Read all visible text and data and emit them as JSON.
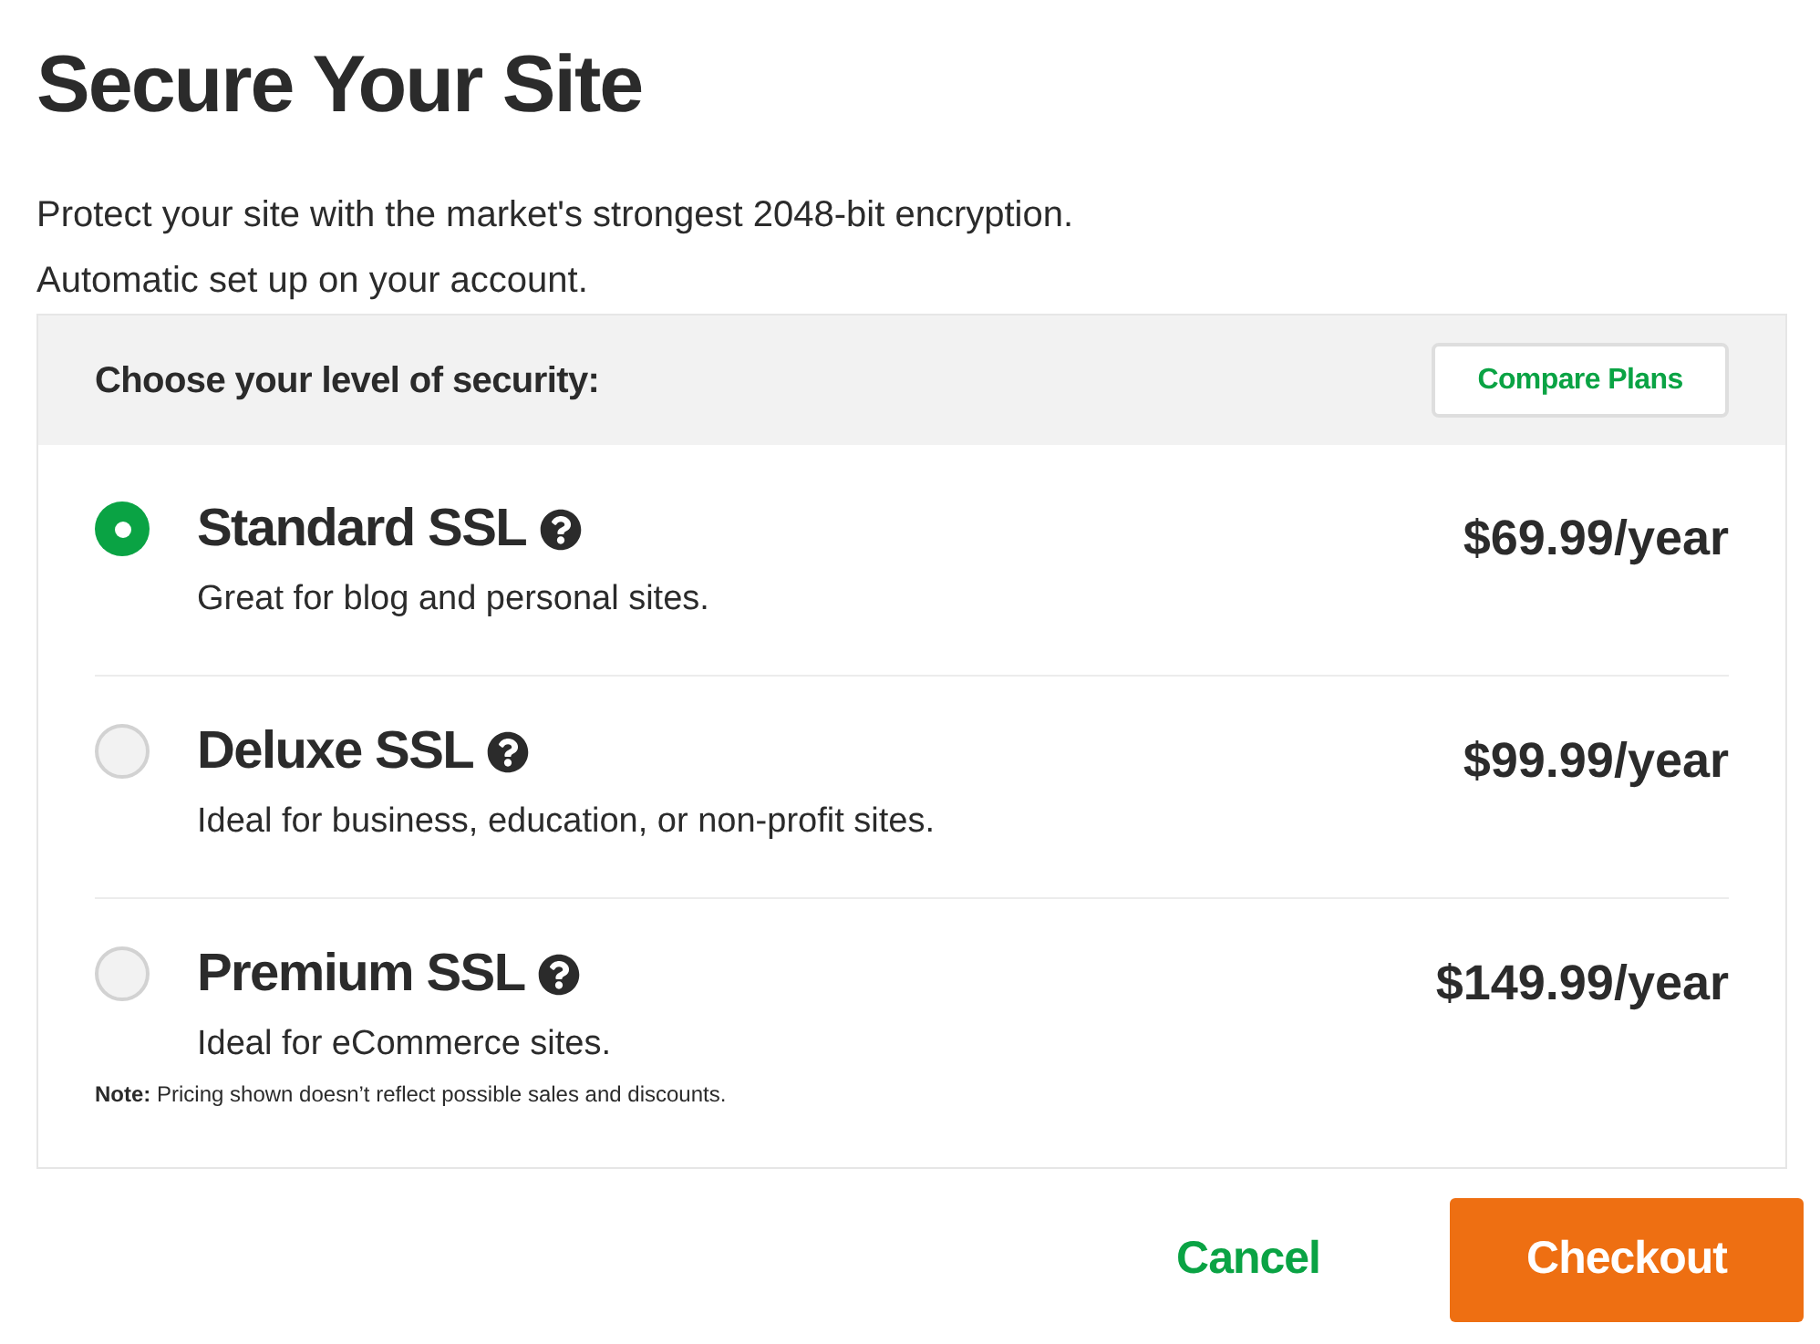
{
  "dialog": {
    "title": "Secure Your Site",
    "intro": [
      "Protect your site with the market's strongest 2048-bit encryption.",
      "Automatic set up on your account."
    ]
  },
  "plans_panel": {
    "heading": "Choose your level of security:",
    "compare_button": "Compare Plans",
    "plans": [
      {
        "name": "Standard SSL",
        "description": "Great for blog and personal sites.",
        "price": "$69.99/year",
        "selected": true
      },
      {
        "name": "Deluxe SSL",
        "description": "Ideal for business, education, or non-profit sites.",
        "price": "$99.99/year",
        "selected": false
      },
      {
        "name": "Premium SSL",
        "description": "Ideal for eCommerce sites.",
        "price": "$149.99/year",
        "selected": false
      }
    ],
    "note": "**Note:** Pricing shown doesn’t reflect possible sales and discounts."
  },
  "actions": {
    "cancel": "Cancel",
    "checkout": "Checkout"
  }
}
